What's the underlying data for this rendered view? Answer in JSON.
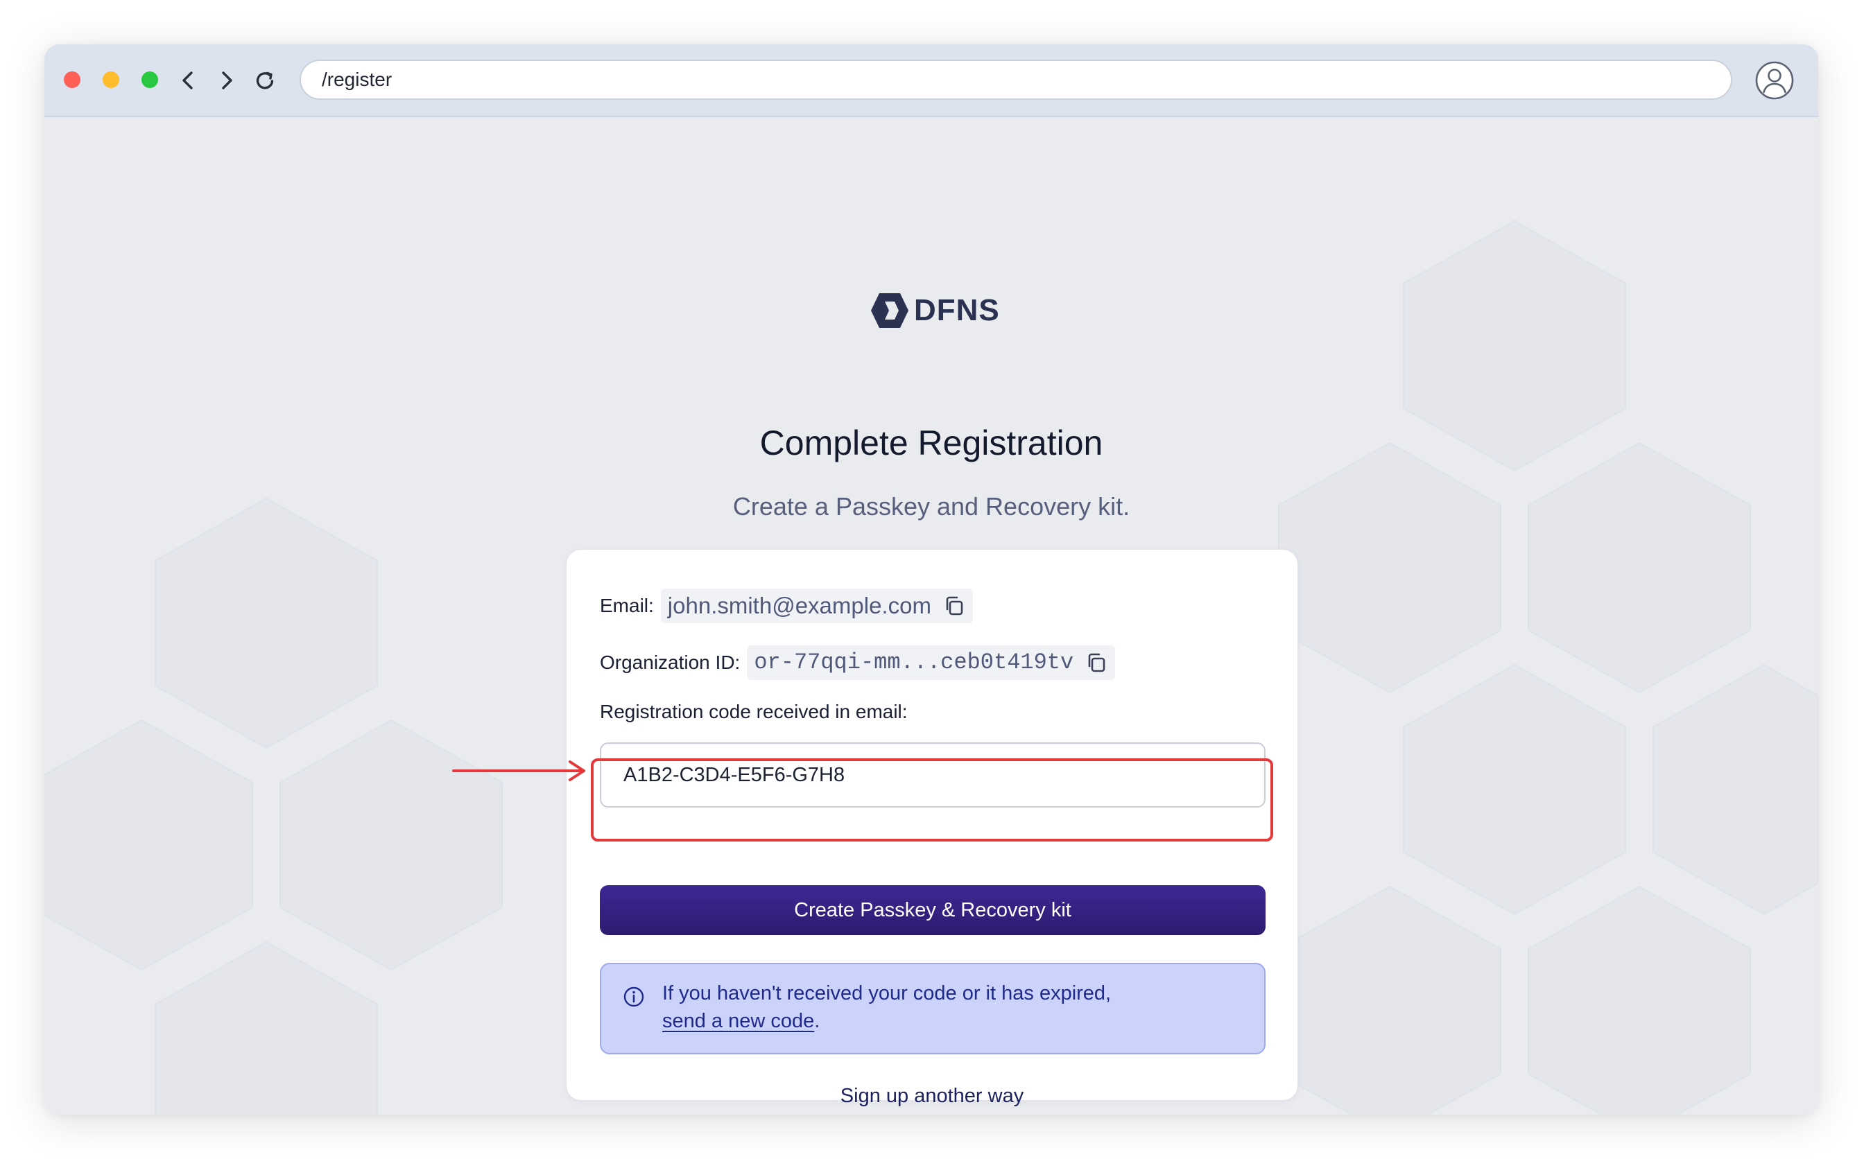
{
  "browser": {
    "url": "/register"
  },
  "brand": {
    "name": "DFNS"
  },
  "page": {
    "title": "Complete Registration",
    "subtitle": "Create a Passkey and Recovery kit."
  },
  "form": {
    "email_label": "Email:",
    "email_value": "john.smith@example.com",
    "org_label": "Organization ID:",
    "org_value": "or-77qqi-mm...ceb0t419tv",
    "code_label": "Registration code received in email:",
    "code_value": "A1B2-C3D4-E5F6-G7H8",
    "submit_label": "Create Passkey & Recovery kit",
    "info_text": "If you haven't received your code or it has expired,",
    "info_link": "send a new code",
    "info_suffix": ".",
    "alt_link": "Sign up another way"
  },
  "colors": {
    "primary_button": "#3f2794",
    "info_background": "#cbd3fb",
    "highlight": "#e5383b"
  },
  "icons": [
    "back-icon",
    "forward-icon",
    "reload-icon",
    "user-profile-icon",
    "copy-icon",
    "info-icon",
    "arrow-right-icon"
  ]
}
